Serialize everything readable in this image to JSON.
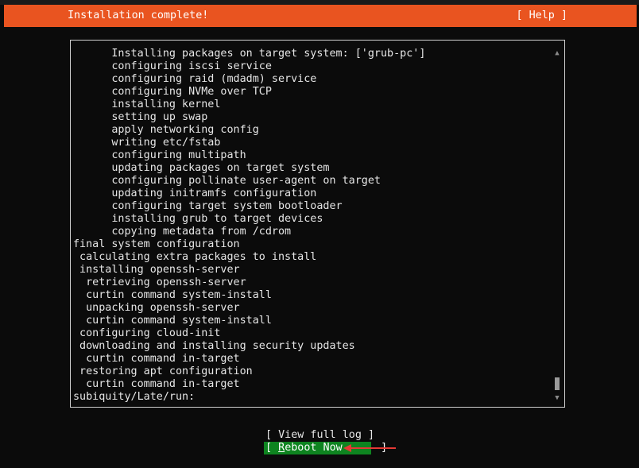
{
  "header": {
    "title": "Installation complete!",
    "help": "[ Help ]"
  },
  "log": {
    "lines": [
      "      Installing packages on target system: ['grub-pc']",
      "      configuring iscsi service",
      "      configuring raid (mdadm) service",
      "      configuring NVMe over TCP",
      "      installing kernel",
      "      setting up swap",
      "      apply networking config",
      "      writing etc/fstab",
      "      configuring multipath",
      "      updating packages on target system",
      "      configuring pollinate user-agent on target",
      "      updating initramfs configuration",
      "      configuring target system bootloader",
      "      installing grub to target devices",
      "      copying metadata from /cdrom",
      "final system configuration",
      " calculating extra packages to install",
      " installing openssh-server",
      "  retrieving openssh-server",
      "  curtin command system-install",
      "  unpacking openssh-server",
      "  curtin command system-install",
      " configuring cloud-init",
      " downloading and installing security updates",
      "  curtin command in-target",
      " restoring apt configuration",
      "  curtin command in-target",
      "subiquity/Late/run:"
    ],
    "scroll_up_glyph": "▲",
    "scroll_down_glyph": "▼"
  },
  "buttons": {
    "view_log": "[ View full log ]",
    "reboot_prefix": "[ ",
    "reboot_hotkey": "R",
    "reboot_rest": "eboot Now",
    "reboot_suffix": "      ]"
  },
  "colors": {
    "header_bg": "#e95420",
    "selected_button_bg": "#0e8420",
    "background": "#0b0b0b",
    "annotation_arrow": "#e53935"
  }
}
